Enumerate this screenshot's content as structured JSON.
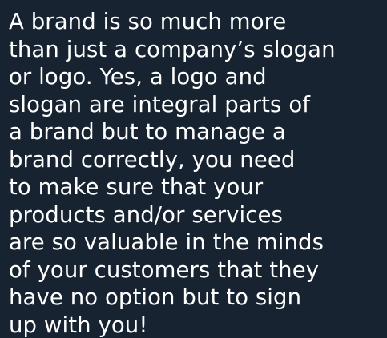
{
  "colors": {
    "background": "#172330",
    "text": "#ffffff"
  },
  "quote": {
    "lines": [
      "A brand is so much more",
      "than just a company’s slogan",
      "or logo. Yes, a logo and",
      "slogan are integral parts of",
      "a brand but to manage a",
      "brand correctly, you need",
      "to make sure that your",
      "products and/or services",
      "are so valuable in the minds",
      "of your customers that they",
      "have no option but to sign",
      "up with you!"
    ]
  }
}
